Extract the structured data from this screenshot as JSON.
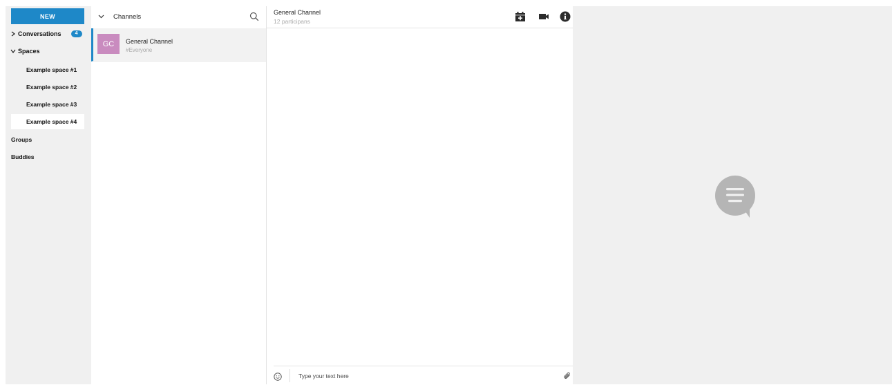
{
  "sidebar": {
    "new_label": "NEW",
    "conversations": {
      "label": "Conversations",
      "count": "4"
    },
    "spaces": {
      "label": "Spaces",
      "items": [
        {
          "label": "Example space #1"
        },
        {
          "label": "Example space #2"
        },
        {
          "label": "Example space #3"
        },
        {
          "label": "Example space #4"
        }
      ],
      "selected_index": 3
    },
    "groups_label": "Groups",
    "buddies_label": "Buddies"
  },
  "channels": {
    "header_label": "Channels",
    "items": [
      {
        "initials": "GC",
        "name": "General Channel",
        "tag": "#Everyone"
      }
    ]
  },
  "chat": {
    "title": "General Channel",
    "subtitle": "12 participans",
    "header_icons": [
      "calendar-add-icon",
      "video-camera-icon",
      "info-icon"
    ],
    "composer": {
      "placeholder": "Type your text here",
      "value": ""
    }
  },
  "right_panel": {
    "icon": "chat-bubble-icon"
  },
  "colors": {
    "accent": "#1e88c8",
    "avatar": "#c98bbf",
    "sidebar_bg": "#f0f0f0",
    "right_bg": "#f0f0f0"
  }
}
